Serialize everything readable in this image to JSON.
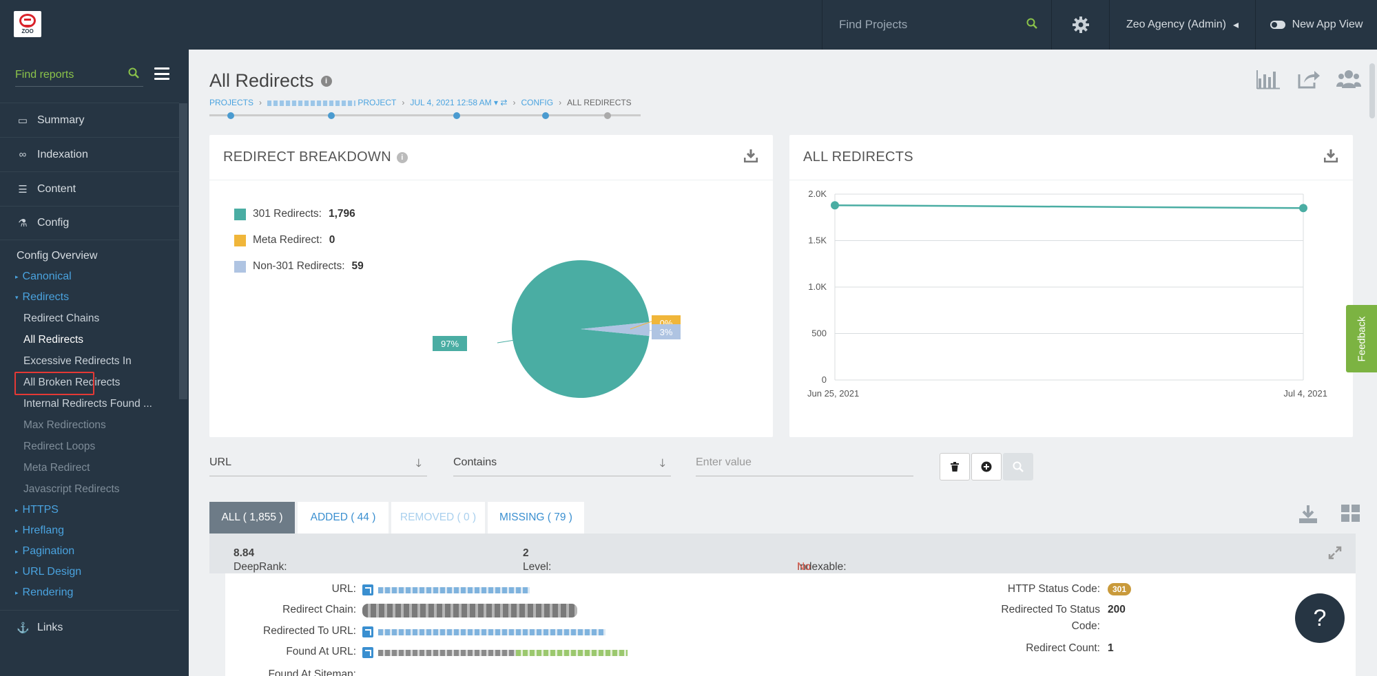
{
  "topbar": {
    "logo_text": "ZOO",
    "search_placeholder": "Find Projects",
    "agency": "Zeo Agency (Admin)",
    "new_app_view": "New App View"
  },
  "sidebar": {
    "search_placeholder": "Find reports",
    "main_items": [
      {
        "label": "Summary",
        "icon": "monitor-icon"
      },
      {
        "label": "Indexation",
        "icon": "binoculars-icon"
      },
      {
        "label": "Content",
        "icon": "list-icon"
      },
      {
        "label": "Config",
        "icon": "flask-icon"
      }
    ],
    "config_overview": "Config Overview",
    "canonical": "Canonical",
    "redirects": "Redirects",
    "redirect_children": [
      "Redirect Chains",
      "All Redirects",
      "Excessive Redirects In",
      "All Broken Redirects",
      "Internal Redirects Found ...",
      "Max Redirections",
      "Redirect Loops",
      "Meta Redirect",
      "Javascript Redirects"
    ],
    "more_sections": [
      "HTTPS",
      "Hreflang",
      "Pagination",
      "URL Design",
      "Rendering"
    ],
    "links": "Links"
  },
  "page": {
    "title": "All Redirects",
    "breadcrumb": {
      "projects": "PROJECTS",
      "project_suffix": "PROJECT",
      "date": "JUL 4, 2021 12:58 AM",
      "config": "CONFIG",
      "current": "ALL REDIRECTS"
    }
  },
  "breakdown_panel": {
    "title": "REDIRECT BREAKDOWN",
    "legend": [
      {
        "label": "301 Redirects:",
        "value": "1,796",
        "color": "#4aada3"
      },
      {
        "label": "Meta Redirect:",
        "value": "0",
        "color": "#f0b63a"
      },
      {
        "label": "Non-301 Redirects:",
        "value": "59",
        "color": "#afc4e2"
      }
    ],
    "slice_labels": {
      "main": "97%",
      "meta": "0%",
      "non301": "3%"
    }
  },
  "chart_data": {
    "type": "line",
    "title": "ALL REDIRECTS",
    "x": [
      "Jun 25, 2021",
      "Jul 4, 2021"
    ],
    "series": [
      {
        "values": [
          1880,
          1850
        ]
      }
    ],
    "y_ticks": [
      "2.0K",
      "1.5K",
      "1.0K",
      "500",
      "0"
    ],
    "ylim": [
      0,
      2000
    ],
    "grid": true,
    "color": "#4aada3"
  },
  "filters": {
    "field": "URL",
    "operator": "Contains",
    "value_placeholder": "Enter value"
  },
  "tabs": [
    {
      "label": "ALL ( 1,855 )"
    },
    {
      "label": "ADDED ( 44 )"
    },
    {
      "label": "REMOVED ( 0 )"
    },
    {
      "label": "MISSING ( 79 )"
    }
  ],
  "record": {
    "deeprank_label": "DeepRank:",
    "deeprank": "8.84",
    "level_label": "Level:",
    "level": "2",
    "indexable_label": "Indexable:",
    "indexable": "No",
    "url_label": "URL:",
    "chain_label": "Redirect Chain:",
    "redirected_to_label": "Redirected To URL:",
    "found_at_label": "Found At URL:",
    "found_sitemap_label": "Found At Sitemap:",
    "http_status_label": "HTTP Status Code:",
    "http_status": "301",
    "redirected_status_label_1": "Redirected To Status",
    "redirected_status_label_2": "Code:",
    "redirected_status": "200",
    "redirect_count_label": "Redirect Count:",
    "redirect_count": "1"
  },
  "feedback": "Feedback",
  "help": "?"
}
